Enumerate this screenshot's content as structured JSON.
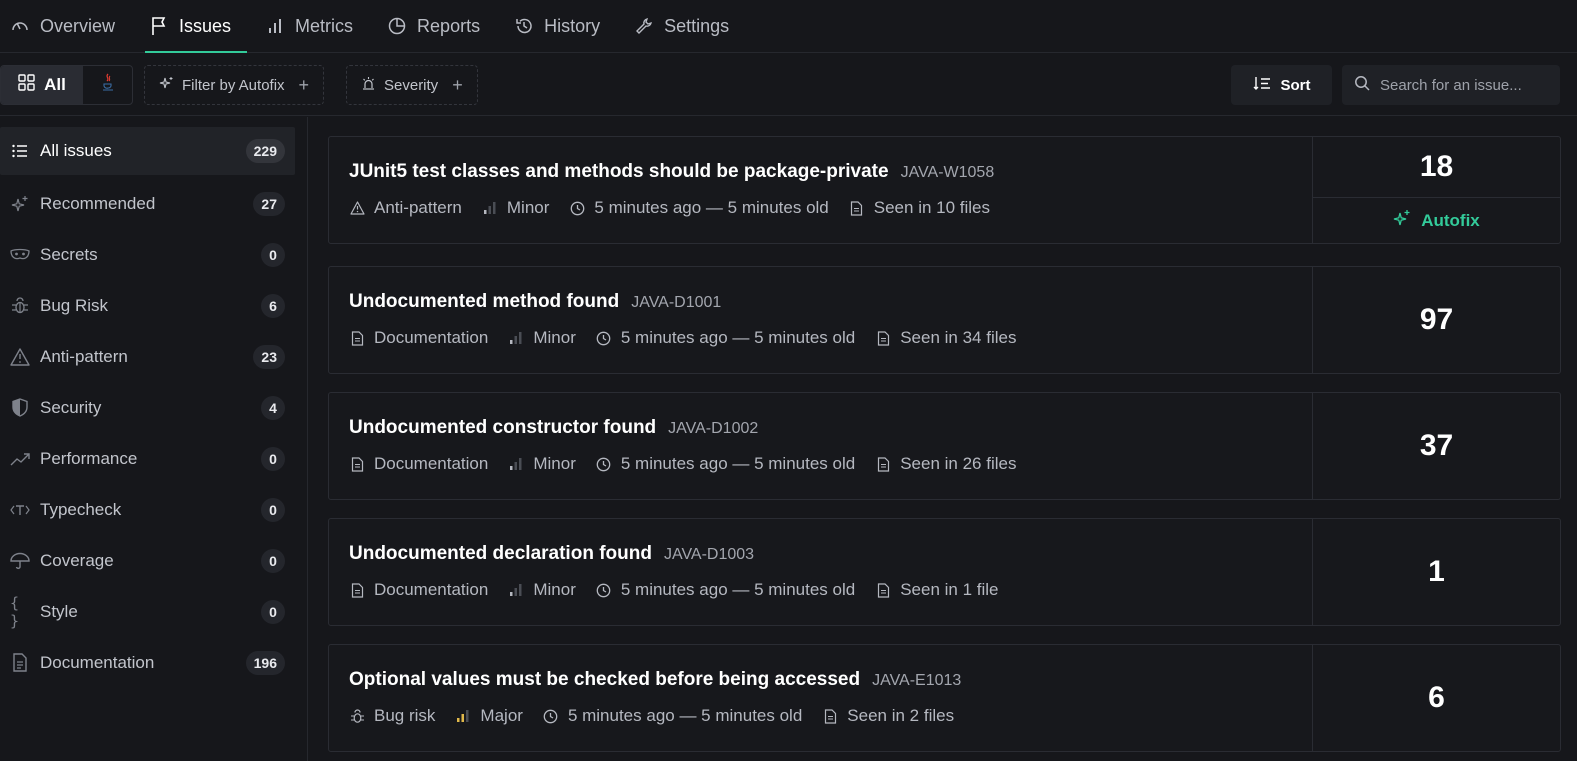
{
  "nav": {
    "tabs": [
      {
        "label": "Overview",
        "icon": "gauge-icon"
      },
      {
        "label": "Issues",
        "icon": "flag-icon",
        "active": true
      },
      {
        "label": "Metrics",
        "icon": "bar-chart-icon"
      },
      {
        "label": "Reports",
        "icon": "pie-chart-icon"
      },
      {
        "label": "History",
        "icon": "history-icon"
      },
      {
        "label": "Settings",
        "icon": "wrench-icon"
      }
    ]
  },
  "toolbar": {
    "all_label": "All",
    "filter_autofix_label": "Filter by Autofix",
    "severity_label": "Severity",
    "sort_label": "Sort",
    "search_placeholder": "Search for an issue..."
  },
  "sidebar": {
    "items": [
      {
        "label": "All issues",
        "count": "229",
        "icon": "list-icon"
      },
      {
        "label": "Recommended",
        "count": "27",
        "icon": "sparkles-icon"
      },
      {
        "label": "Secrets",
        "count": "0",
        "icon": "mask-icon"
      },
      {
        "label": "Bug Risk",
        "count": "6",
        "icon": "bug-icon"
      },
      {
        "label": "Anti-pattern",
        "count": "23",
        "icon": "warning-icon"
      },
      {
        "label": "Security",
        "count": "4",
        "icon": "shield-icon"
      },
      {
        "label": "Performance",
        "count": "0",
        "icon": "trending-up-icon"
      },
      {
        "label": "Typecheck",
        "count": "0",
        "icon": "type-icon"
      },
      {
        "label": "Coverage",
        "count": "0",
        "icon": "umbrella-icon"
      },
      {
        "label": "Style",
        "count": "0",
        "icon": "braces-icon"
      },
      {
        "label": "Documentation",
        "count": "196",
        "icon": "document-icon"
      }
    ]
  },
  "issues": [
    {
      "title": "JUnit5 test classes and methods should be package-private",
      "code": "JAVA-W1058",
      "category": "Anti-pattern",
      "severity": "Minor",
      "age": "5 minutes ago — 5 minutes old",
      "seen": "Seen in 10 files",
      "occurrences": "18",
      "autofix": "Autofix"
    },
    {
      "title": "Undocumented method found",
      "code": "JAVA-D1001",
      "category": "Documentation",
      "severity": "Minor",
      "age": "5 minutes ago — 5 minutes old",
      "seen": "Seen in 34 files",
      "occurrences": "97"
    },
    {
      "title": "Undocumented constructor found",
      "code": "JAVA-D1002",
      "category": "Documentation",
      "severity": "Minor",
      "age": "5 minutes ago — 5 minutes old",
      "seen": "Seen in 26 files",
      "occurrences": "37"
    },
    {
      "title": "Undocumented declaration found",
      "code": "JAVA-D1003",
      "category": "Documentation",
      "severity": "Minor",
      "age": "5 minutes ago — 5 minutes old",
      "seen": "Seen in 1 file",
      "occurrences": "1"
    },
    {
      "title": "Optional values must be checked before being accessed",
      "code": "JAVA-E1013",
      "category": "Bug risk",
      "severity": "Major",
      "age": "5 minutes ago — 5 minutes old",
      "seen": "Seen in 2 files",
      "occurrences": "6"
    }
  ],
  "colors": {
    "accent": "#33cb9a",
    "minor": "#8a8e96",
    "major": "#e0b84a",
    "java_logo": "#e03c31"
  }
}
